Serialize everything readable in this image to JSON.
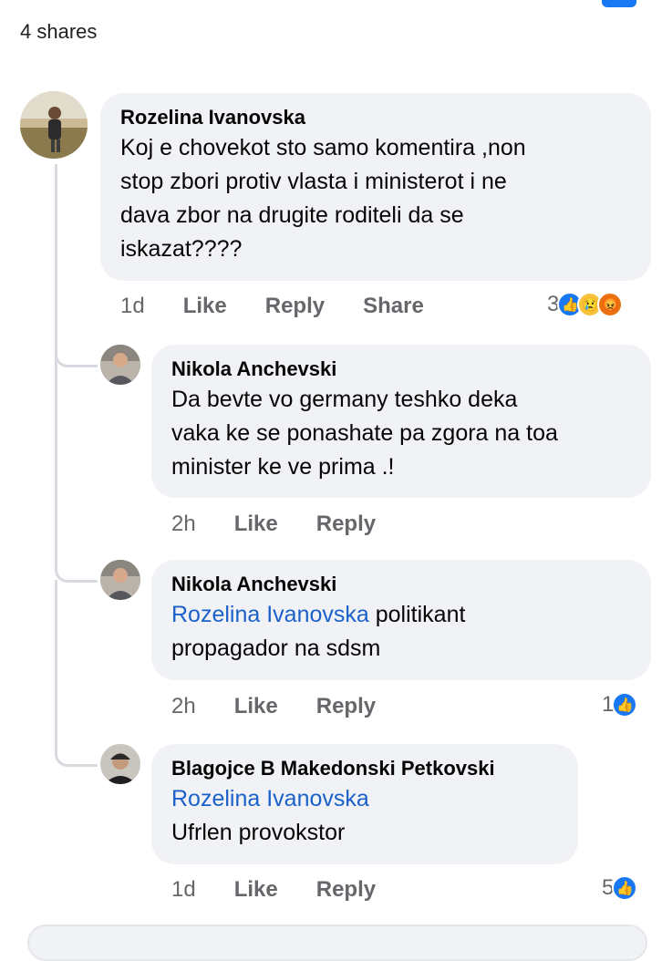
{
  "post": {
    "shares_label": "4 shares"
  },
  "comments": [
    {
      "author": "Rozelina Ivanovska",
      "lines": [
        "Koj e chovekot sto samo komentira ,non",
        "stop zbori protiv vlasta i ministerot i ne",
        "dava zbor na drugite roditeli da se",
        "iskazat????"
      ],
      "time": "1d",
      "actions": [
        "Like",
        "Reply",
        "Share"
      ],
      "reaction_count": "3",
      "reaction_icons": [
        "like-reaction-icon",
        "sad-reaction-icon",
        "angry-reaction-icon"
      ]
    },
    {
      "author": "Nikola Anchevski",
      "lines": [
        "Da bevte vo germany teshko deka",
        "vaka ke se ponashate pa zgora na toa",
        "minister ke ve prima .!"
      ],
      "time": "2h",
      "actions": [
        "Like",
        "Reply"
      ]
    },
    {
      "author": "Nikola Anchevski",
      "mention": "Rozelina Ivanovska",
      "lines": [
        " politikant",
        "propagador na sdsm"
      ],
      "time": "2h",
      "actions": [
        "Like",
        "Reply"
      ],
      "reaction_count": "1",
      "reaction_icons": [
        "like-reaction-icon"
      ]
    },
    {
      "author": "Blagojce B Makedonski Petkovski",
      "mention": "Rozelina Ivanovska",
      "lines": [
        "Ufrlen provokstor"
      ],
      "time": "1d",
      "actions": [
        "Like",
        "Reply"
      ],
      "reaction_count": "5",
      "reaction_icons": [
        "like-reaction-icon"
      ]
    }
  ],
  "colors": {
    "like_blue": "#1877f2",
    "mention_blue": "#1b61c9",
    "bubble_bg": "#f0f2f5",
    "meta_gray": "#65676b"
  }
}
